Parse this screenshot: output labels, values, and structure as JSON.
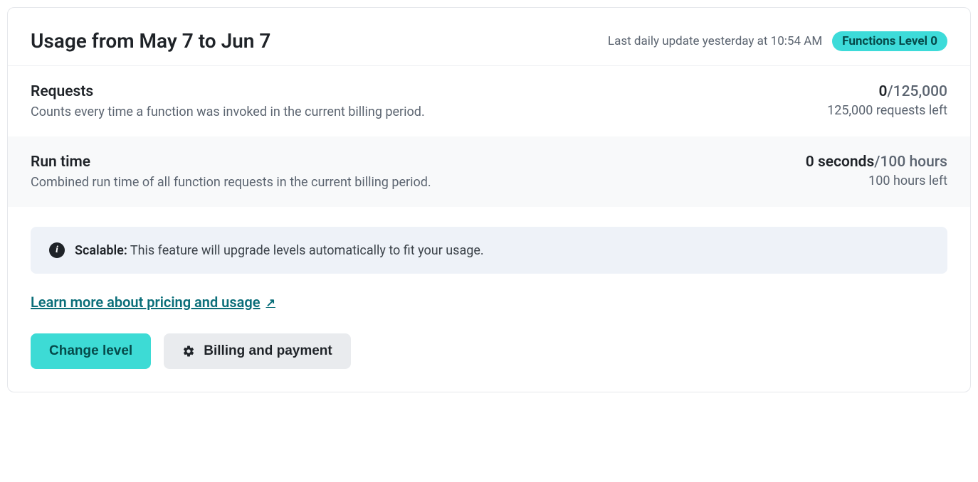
{
  "header": {
    "title": "Usage from May 7 to Jun 7",
    "update_text": "Last daily update yesterday at 10:54 AM",
    "level_badge": "Functions Level 0"
  },
  "metrics": {
    "requests": {
      "title": "Requests",
      "description": "Counts every time a function was invoked in the current billing period.",
      "used": "0",
      "limit": "/125,000",
      "remaining": "125,000 requests left"
    },
    "runtime": {
      "title": "Run time",
      "description": "Combined run time of all function requests in the current billing period.",
      "used": "0 seconds",
      "limit": "/100 hours",
      "remaining": "100 hours left"
    }
  },
  "info": {
    "label": "Scalable:",
    "text": " This feature will upgrade levels automatically to fit your usage."
  },
  "link": {
    "text": "Learn more about pricing and usage"
  },
  "buttons": {
    "change_level": "Change level",
    "billing": "Billing and payment"
  }
}
